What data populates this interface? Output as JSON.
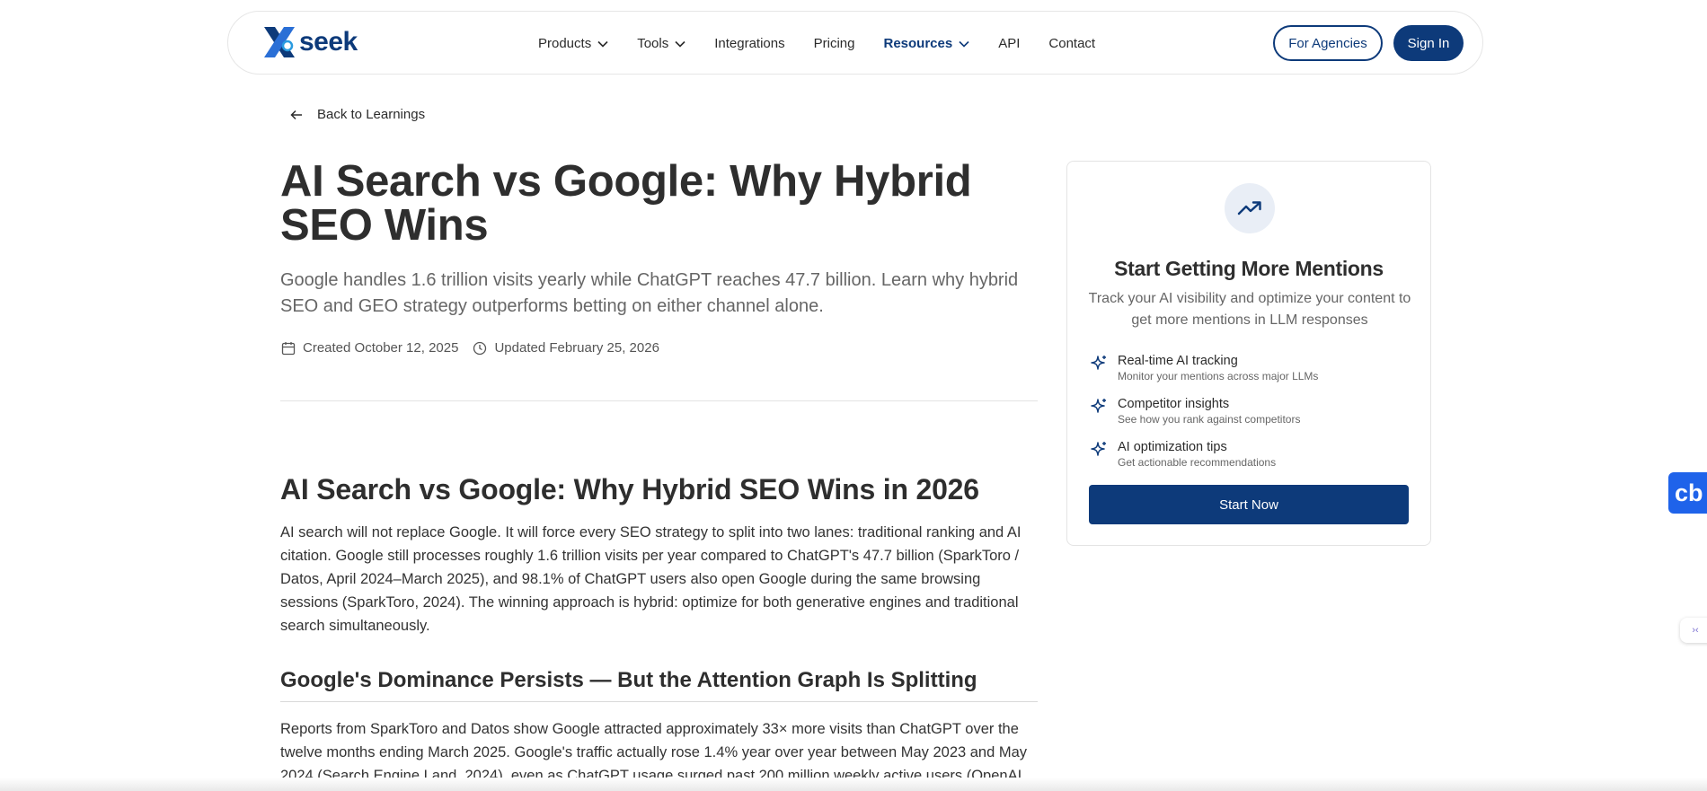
{
  "brand": {
    "name": "seek",
    "accent": "#0d3a7a"
  },
  "nav": {
    "items": [
      {
        "label": "Products",
        "dropdown": true
      },
      {
        "label": "Tools",
        "dropdown": true
      },
      {
        "label": "Integrations",
        "dropdown": false
      },
      {
        "label": "Pricing",
        "dropdown": false
      },
      {
        "label": "Resources",
        "dropdown": true,
        "active": true
      },
      {
        "label": "API",
        "dropdown": false
      },
      {
        "label": "Contact",
        "dropdown": false
      }
    ],
    "agencies_label": "For Agencies",
    "signin_label": "Sign In"
  },
  "back_link": "Back to Learnings",
  "article": {
    "title": "AI Search vs Google: Why Hybrid SEO Wins",
    "subtitle": "Google handles 1.6 trillion visits yearly while ChatGPT reaches 47.7 billion. Learn why hybrid SEO and GEO strategy outperforms betting on either channel alone.",
    "created": "Created October 12, 2025",
    "updated": "Updated February 25, 2026",
    "h2": "AI Search vs Google: Why Hybrid SEO Wins in 2026",
    "p1": "AI search will not replace Google. It will force every SEO strategy to split into two lanes: traditional ranking and AI citation. Google still processes roughly 1.6 trillion visits per year compared to ChatGPT's 47.7 billion (SparkToro / Datos, April 2024–March 2025), and 98.1% of ChatGPT users also open Google during the same browsing sessions (SparkToro, 2024). The winning approach is hybrid: optimize for both generative engines and traditional search simultaneously.",
    "h3": "Google's Dominance Persists — But the Attention Graph Is Splitting",
    "p2": "Reports from SparkToro and Datos show Google attracted approximately 33× more visits than ChatGPT over the twelve months ending March 2025. Google's traffic actually rose 1.4% year over year between May 2023 and May 2024 (Search Engine Land, 2024), even as ChatGPT usage surged past 200 million weekly active users (OpenAI,"
  },
  "sidebar": {
    "icon": "trending-up-icon",
    "title": "Start Getting More Mentions",
    "subtitle": "Track your AI visibility and optimize your content to get more mentions in LLM responses",
    "features": [
      {
        "title": "Real-time AI tracking",
        "desc": "Monitor your mentions across major LLMs"
      },
      {
        "title": "Competitor insights",
        "desc": "See how you rank against competitors"
      },
      {
        "title": "AI optimization tips",
        "desc": "Get actionable recommendations"
      }
    ],
    "cta": "Start Now"
  },
  "widgets": {
    "cb_label": "cb",
    "small_tab_label": "›‹"
  }
}
